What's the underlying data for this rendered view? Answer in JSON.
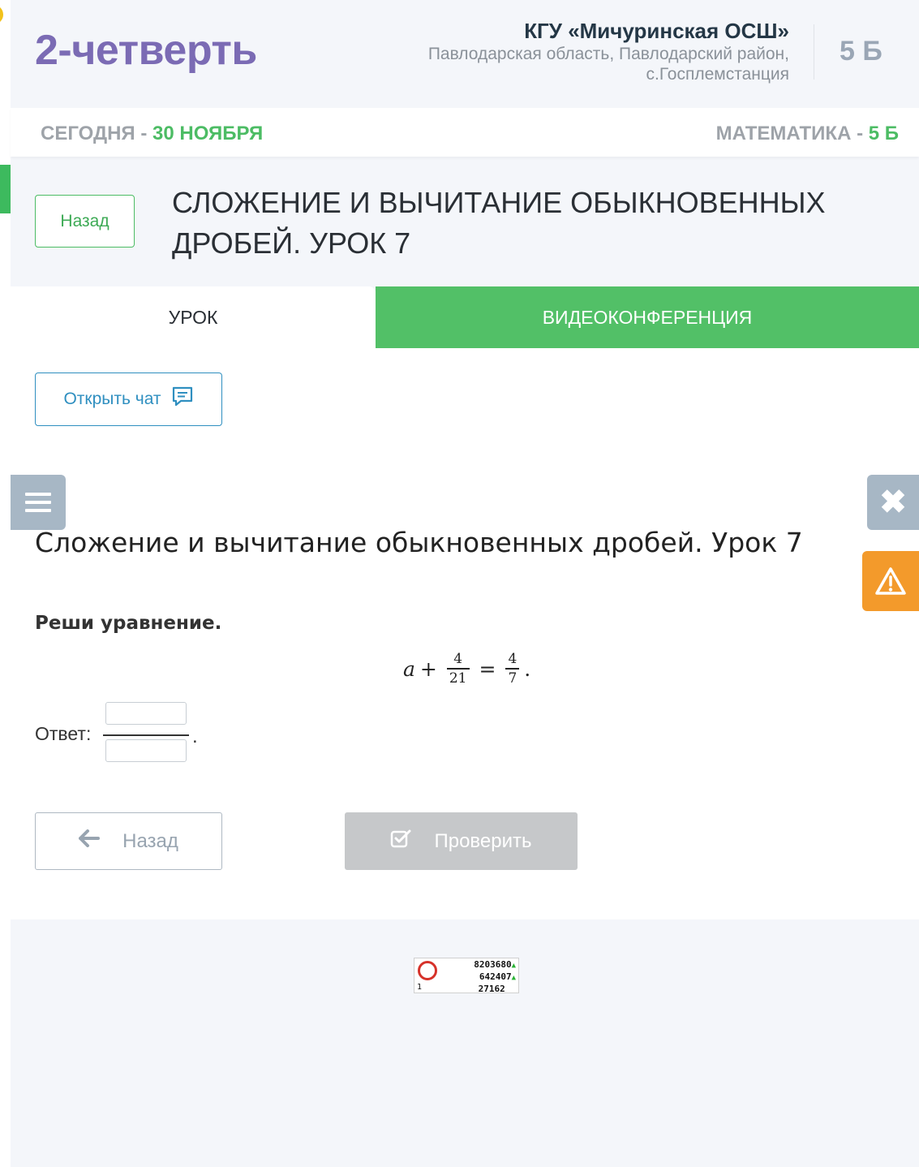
{
  "header": {
    "quarter_title": "2-четверть",
    "school_name": "КГУ «Мичуринская ОСШ»",
    "school_address_line1": "Павлодарская область, Павлодарский район,",
    "school_address_line2": "с.Госплемстанция",
    "class_label": "5 Б"
  },
  "datebar": {
    "today_label": "СЕГОДНЯ - ",
    "today_date": "30 НОЯБРЯ",
    "subject_label": "МАТЕМАТИКА - ",
    "subject_class": "5 Б"
  },
  "lesson": {
    "back_label": "Назад",
    "title": "СЛОЖЕНИЕ И ВЫЧИТАНИЕ ОБЫКНОВЕННЫХ ДРОБЕЙ. УРОК 7"
  },
  "tabs": [
    {
      "label": "УРОК",
      "active": true
    },
    {
      "label": "ВИДЕОКОНФЕРЕНЦИЯ",
      "active": false
    }
  ],
  "main": {
    "chat_button_label": "Открыть чат",
    "task_title": "Сложение и вычитание обыкновенных дробей. Урок 7",
    "instruction": "Реши уравнение.",
    "equation": {
      "variable": "a",
      "plus": "+",
      "frac1_num": "4",
      "frac1_den": "21",
      "equals": "=",
      "frac2_num": "4",
      "frac2_den": "7",
      "end": "."
    },
    "answer_label": "Ответ:",
    "answer_end": ".",
    "answer_numerator_value": "",
    "answer_denominator_value": "",
    "back_button_label": "Назад",
    "check_button_label": "Проверить"
  },
  "side_buttons": {
    "menu_icon": "hamburger-icon",
    "close_icon": "close-icon",
    "warning_icon": "warning-icon"
  },
  "counter": {
    "line1": "8203680",
    "line2": "642407",
    "line3": "27162",
    "corner": "1"
  },
  "colors": {
    "accent_green": "#52c067",
    "title_purple": "#7b6bb4",
    "chat_blue": "#2f8fc0",
    "warning_orange": "#f39a2b",
    "disabled_gray": "#c6c8ca"
  }
}
